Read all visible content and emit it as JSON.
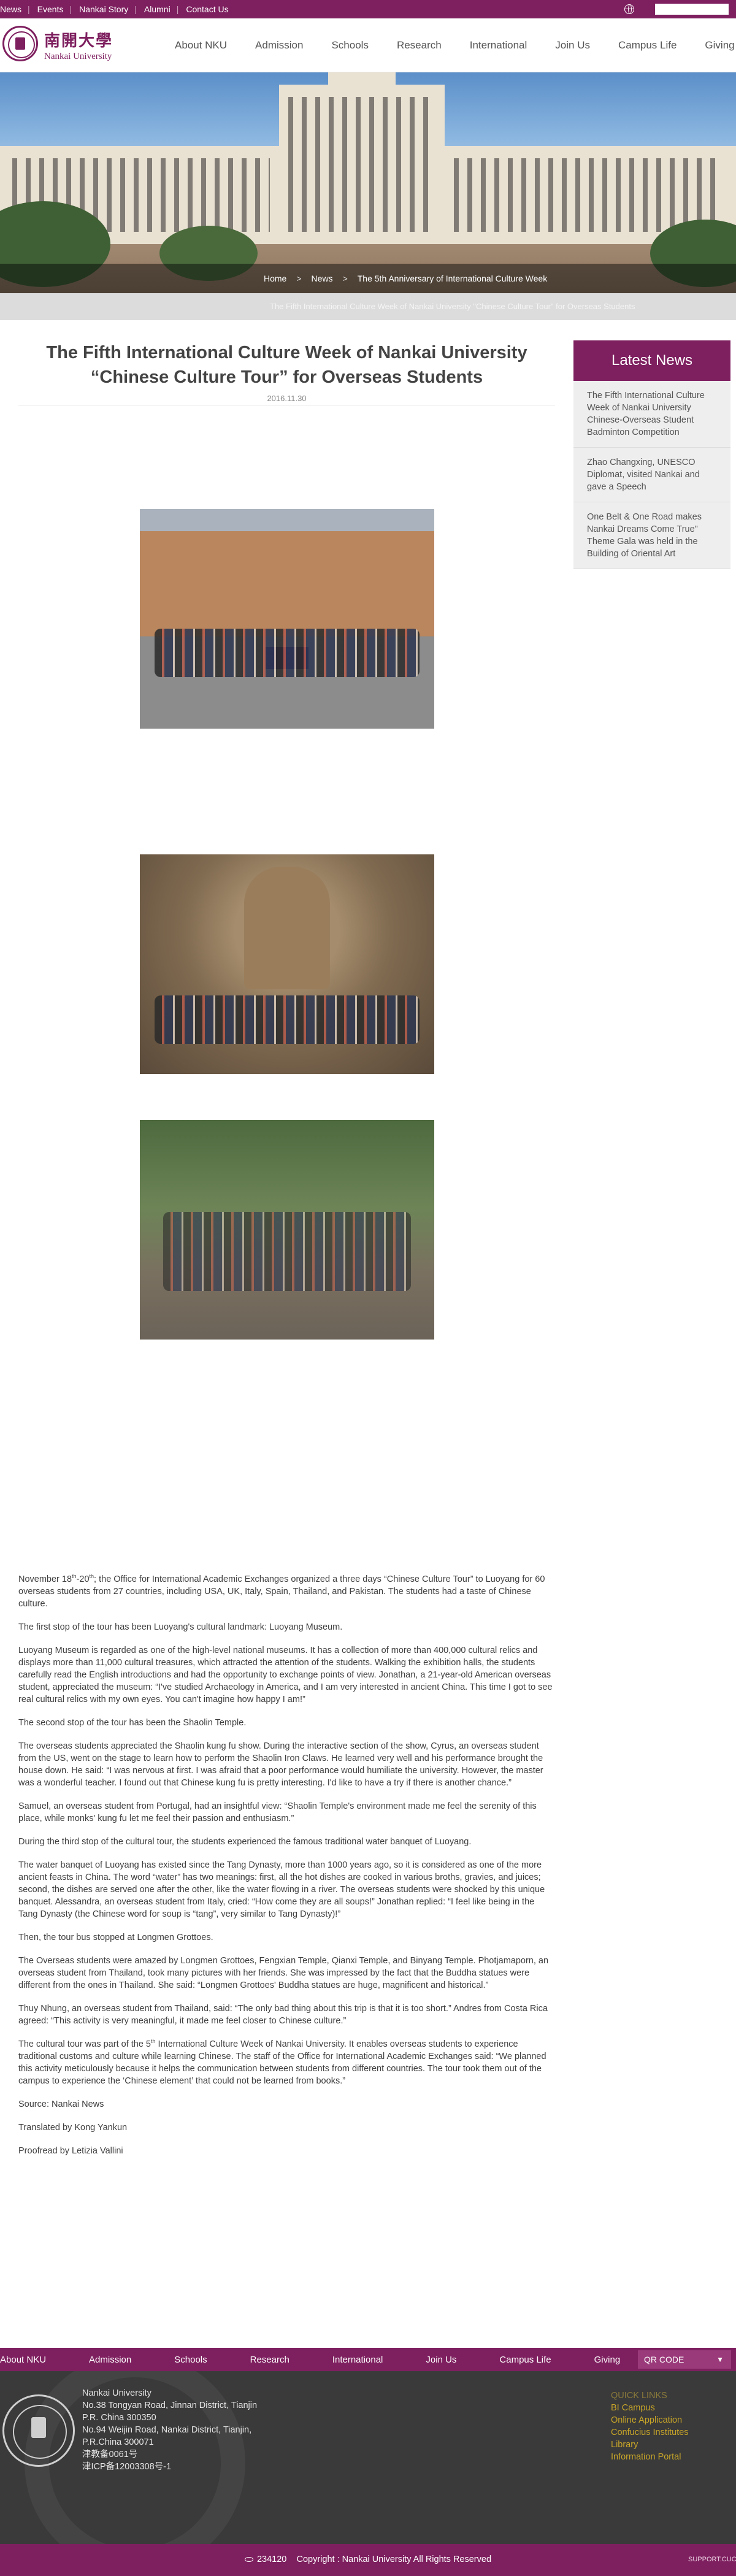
{
  "topbar": {
    "links": [
      "News",
      "Events",
      "Nankai Story",
      "Alumni",
      "Contact Us"
    ],
    "search_placeholder": ""
  },
  "header": {
    "logo_cn": "南開大學",
    "logo_en": "Nankai University",
    "nav": [
      "About NKU",
      "Admission",
      "Schools",
      "Research",
      "International",
      "Join Us",
      "Campus Life",
      "Giving"
    ]
  },
  "breadcrumb": {
    "home": "Home",
    "news": "News",
    "current": "The 5th Anniversary of International Culture Week"
  },
  "ticker": "The Fifth International Culture Week of Nankai University \"Chinese Culture Tour\" for Overseas Students",
  "article": {
    "title_line1": "The Fifth International Culture Week of Nankai University",
    "title_line2": "“Chinese Culture Tour” for Overseas Students",
    "date": "2016.11.30",
    "p1_a": "November 18",
    "p1_sup1": "th",
    "p1_b": "-20",
    "p1_sup2": "th",
    "p1_c": "; the Office for International Academic Exchanges organized a three days “Chinese Culture Tour” to Luoyang for 60 overseas students from 27 countries, including USA, UK, Italy, Spain, Thailand, and Pakistan. The students had a taste of Chinese culture.",
    "p2": "The first stop of the tour has been Luoyang's cultural landmark: Luoyang Museum.",
    "p3": "Luoyang Museum is regarded as one of the high-level national museums. It has a collection of more than 400,000 cultural relics and displays more than 11,000 cultural treasures, which attracted the attention of the students. Walking the exhibition halls, the students carefully read the English introductions and had the opportunity to exchange points of view. Jonathan, a 21-year-old American overseas student, appreciated the museum: “I've studied Archaeology in America, and I am very interested in ancient China. This time I got to see real cultural relics with my own eyes. You can't imagine how happy I am!”",
    "p4": "The second stop of the tour has been the Shaolin Temple.",
    "p5": "The overseas students appreciated the Shaolin kung fu show. During the interactive section of the show, Cyrus, an overseas student from the US, went on the stage to learn how to perform the Shaolin Iron Claws. He learned very well and his performance brought the house down. He said: “I was nervous at first. I was afraid that a poor performance would humiliate the university. However, the master was a wonderful teacher. I found out that Chinese kung fu is pretty interesting. I'd like to have a try if there is another chance.”",
    "p6": "Samuel, an overseas student from Portugal, had an insightful view: “Shaolin Temple's environment made me feel the serenity of this place, while monks' kung fu let me feel their passion and enthusiasm.”",
    "p7": "During the third stop of the cultural tour, the students experienced the famous traditional water banquet of Luoyang.",
    "p8": "The water banquet of Luoyang has existed since the Tang Dynasty, more than 1000 years ago, so it is considered as one of the more ancient feasts in China. The word “water” has two meanings: first, all the hot dishes are cooked in various broths, gravies, and juices; second, the dishes are served one after the other, like the water flowing in a river. The overseas students were shocked by this unique banquet. Alessandra, an overseas student from Italy, cried: “How come they are all soups!” Jonathan replied: “I feel like being in the Tang Dynasty (the Chinese word for soup is “tang”, very similar to Tang Dynasty)!”",
    "p9": "Then, the tour bus stopped at Longmen Grottoes.",
    "p10": "The Overseas students were amazed by Longmen Grottoes, Fengxian Temple, Qianxi Temple, and Binyang Temple. Photjamaporn, an overseas student from Thailand, took many pictures with her friends. She was impressed by the fact that the Buddha statues were different from the ones in Thailand. She said: “Longmen Grottoes' Buddha statues are huge, magnificent and historical.”",
    "p11": "Thuy Nhung, an overseas student from Thailand, said: “The only bad thing about this trip is that it is too short.” Andres from Costa Rica agreed: “This activity is very meaningful, it made me feel closer to Chinese culture.”",
    "p12_a": "The cultural tour was part of the 5",
    "p12_sup": "th",
    "p12_b": " International Culture Week of Nankai University. It enables overseas students to experience traditional customs and culture while learning Chinese. The staff of the Office for International Academic Exchanges said: “We planned this activity meticulously because it helps the communication between students from different countries. The tour took them out of the campus to experience the ‘Chinese element’ that could not be learned from books.”",
    "source": "Source: Nankai News",
    "translated": "Translated by Kong Yankun",
    "proofread": "Proofread by Letizia Vallini"
  },
  "sidebar": {
    "heading": "Latest News",
    "items": [
      "The Fifth International Culture Week of Nankai University Chinese-Overseas Student Badminton Competition",
      "Zhao Changxing, UNESCO Diplomat, visited Nankai and gave a Speech",
      "One Belt & One Road makes Nankai Dreams Come True\" Theme Gala was held in the Building of Oriental Art"
    ]
  },
  "footer": {
    "nav": [
      "About NKU",
      "Admission",
      "Schools",
      "Research",
      "International",
      "Join Us",
      "Campus Life",
      "Giving"
    ],
    "qr_label": "QR CODE",
    "address_lines": [
      "Nankai University",
      "No.38 Tongyan Road, Jinnan District, Tianjin",
      "P.R. China 300350",
      "No.94 Weijin Road,  Nankai District, Tianjin,",
      "P.R.China  300071",
      "津教备0061号",
      "津ICP备12003308号-1"
    ],
    "quick_heading": "QUICK LINKS",
    "quick_links": [
      "BI Campus",
      "Online Application",
      "Confucius Institutes",
      "Library",
      "Information Portal"
    ],
    "visits": "234120",
    "copyright": "Copyright : Nankai University All Rights Reserved",
    "support": "SUPPORT:CUCAL"
  },
  "colors": {
    "brand": "#7e1f5f",
    "footer_bg": "#3a3a3a",
    "quick_links": "#c9a628"
  }
}
